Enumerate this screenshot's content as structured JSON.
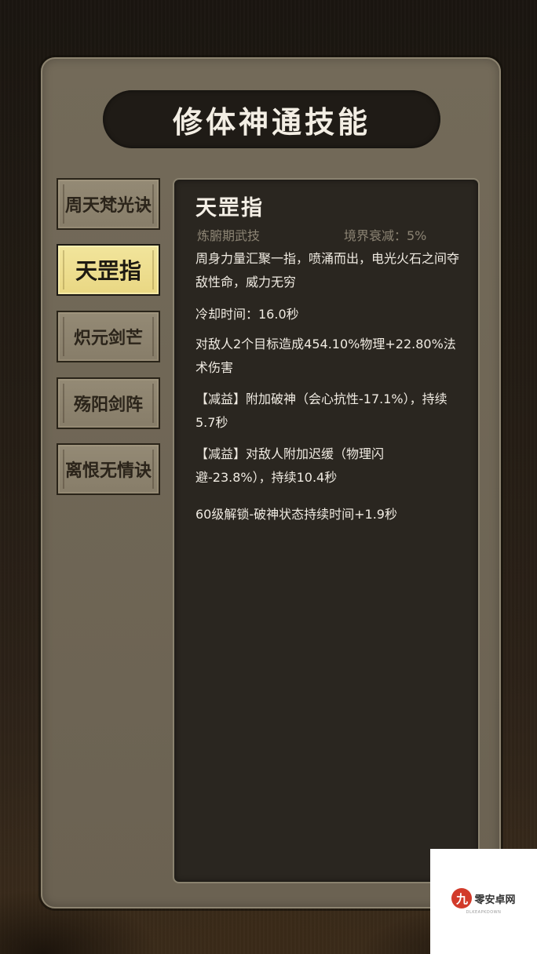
{
  "title": "修体神通技能",
  "tabs": [
    {
      "label": "周天梵光诀",
      "active": false
    },
    {
      "label": "天罡指",
      "active": true
    },
    {
      "label": "炽元剑芒",
      "active": false
    },
    {
      "label": "殇阳剑阵",
      "active": false
    },
    {
      "label": "离恨无情诀",
      "active": false
    }
  ],
  "detail": {
    "name": "天罡指",
    "type": "炼腑期武技",
    "decay": "境界衰减：5%",
    "description": "周身力量汇聚一指，喷涌而出，电光火石之间夺敌性命，威力无穷",
    "cooldown": "冷却时间：16.0秒",
    "damage": "对敌人2个目标造成454.10%物理+22.80%法术伤害",
    "debuff1": "【减益】附加破神（会心抗性-17.1%），持续5.7秒",
    "debuff2": "【减益】对敌人附加迟缓（物理闪避-23.8%），持续10.4秒",
    "unlock": "60级解锁-破神状态持续时间+1.9秒"
  },
  "watermark": {
    "logo_char": "九",
    "text": "零安卓网",
    "subtext": "DLKEAPKDOWN"
  },
  "colors": {
    "panel": "#736a59",
    "detail_bg": "#2a2620",
    "active_tab": "#f2e59c",
    "title_bar": "#1f1b16"
  }
}
